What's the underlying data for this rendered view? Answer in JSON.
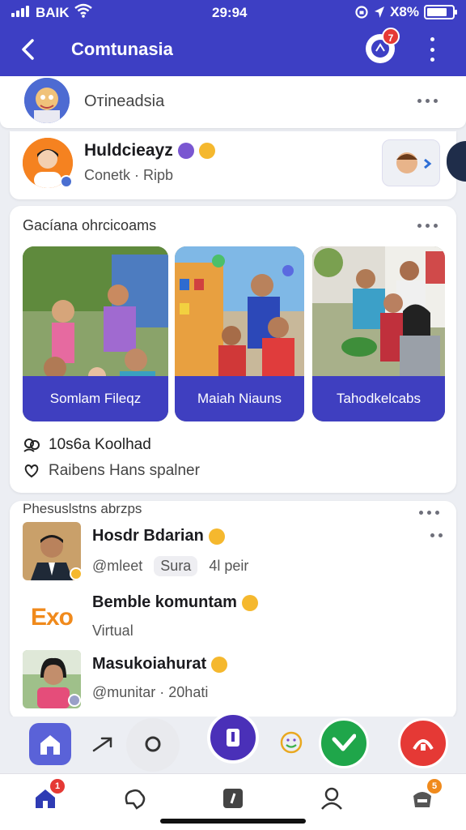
{
  "status_bar": {
    "carrier": "BAIK",
    "time": "29:94",
    "battery": "X8%"
  },
  "header": {
    "title": "Comtunasia",
    "notification_count": "7"
  },
  "group": {
    "name": "Oтineadsia"
  },
  "profile": {
    "name": "Huldcieayz",
    "subtitle": "Conetk · Ripb"
  },
  "featured": {
    "title": "Gacíana ohrcicoams",
    "tiles": [
      {
        "label": "Somlam Fileqz"
      },
      {
        "label": "Maiah Niauns"
      },
      {
        "label": "Tahodkelcabs"
      }
    ],
    "meta_1": "10s6a Koolhad",
    "meta_2": "Raibens Hans spalner"
  },
  "people": {
    "title": "Phesuslstns abrzps",
    "items": [
      {
        "name": "Hosdr Bdarian",
        "handle": "@mleet",
        "chip": "Sura",
        "extra": "4l peir"
      },
      {
        "name": "Bemble komuntam",
        "handle": "Virtual",
        "logo_text": "Exo"
      },
      {
        "name": "Masukoiahurat",
        "handle": "@munitar · 20hati"
      }
    ]
  },
  "tabbar": {
    "home_badge": "1",
    "store_badge": "5"
  },
  "colors": {
    "brand": "#3d3fc4",
    "badge": "#e53935",
    "accent_green": "#1fa64a",
    "accent_red": "#e53935"
  }
}
